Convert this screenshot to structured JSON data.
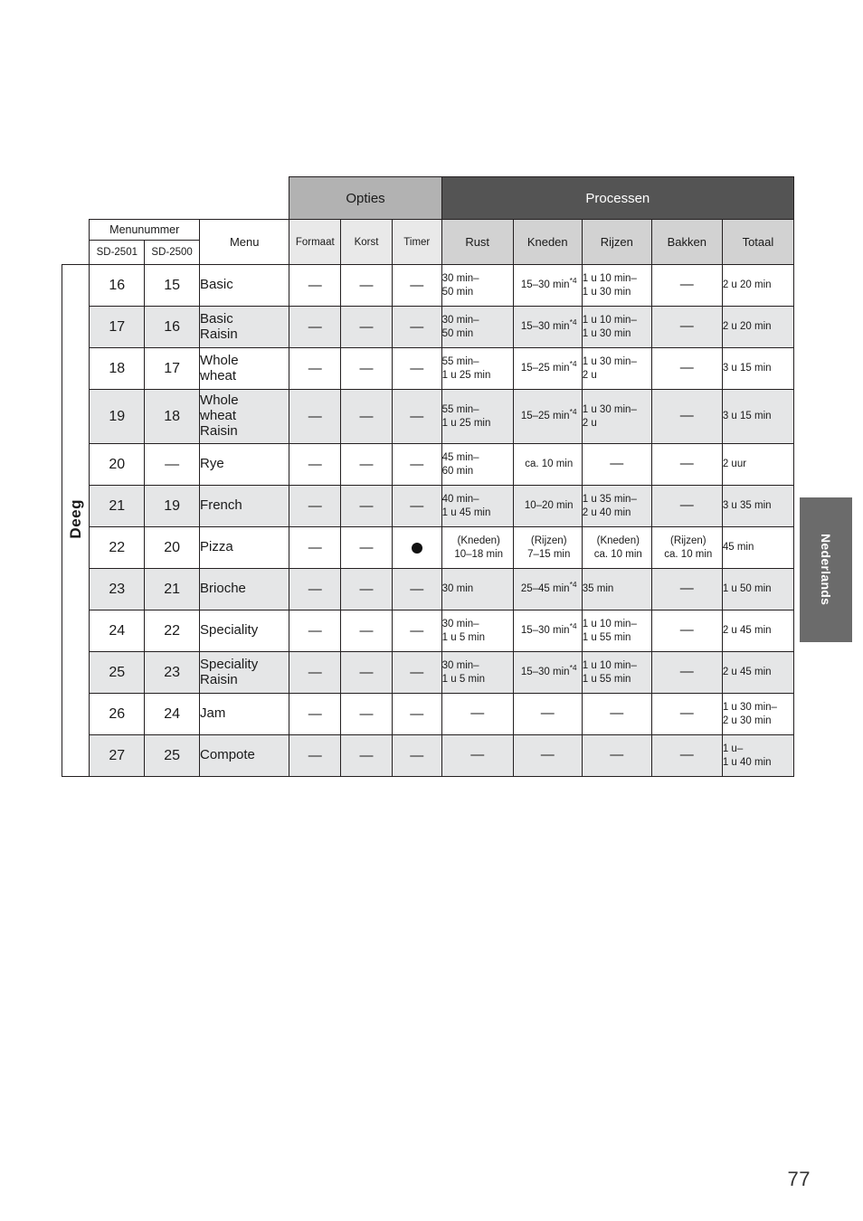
{
  "page": {
    "number": "77",
    "side_tab": "Nederlands"
  },
  "table": {
    "group_headers": {
      "opties": "Opties",
      "processen": "Processen"
    },
    "sub_headers": {
      "menunummer": "Menunummer",
      "model_1": "SD-2501",
      "model_2": "SD-2500",
      "menu": "Menu",
      "formaat": "Formaat",
      "korst": "Korst",
      "timer": "Timer",
      "rust": "Rust",
      "kneden": "Kneden",
      "rijzen": "Rijzen",
      "bakken": "Bakken",
      "totaal": "Totaal"
    },
    "category_label": "Deeg",
    "symbols": {
      "dash": "—",
      "dot": "●"
    },
    "rows": [
      {
        "sd2501": "16",
        "sd2500": "15",
        "menu": "Basic",
        "formaat": "—",
        "korst": "—",
        "timer": "—",
        "rust": "30 min–\n50 min",
        "kneden": "15–30 min",
        "kneden_note": "*4",
        "rijzen": "1 u 10 min–\n1 u 30 min",
        "bakken": "—",
        "totaal": "2 u 20 min"
      },
      {
        "sd2501": "17",
        "sd2500": "16",
        "menu": "Basic\nRaisin",
        "formaat": "—",
        "korst": "—",
        "timer": "—",
        "rust": "30 min–\n50 min",
        "kneden": "15–30 min",
        "kneden_note": "*4",
        "rijzen": "1 u 10 min–\n1 u 30 min",
        "bakken": "—",
        "totaal": "2 u 20 min"
      },
      {
        "sd2501": "18",
        "sd2500": "17",
        "menu": "Whole\nwheat",
        "formaat": "—",
        "korst": "—",
        "timer": "—",
        "rust": "55 min–\n1 u 25 min",
        "kneden": "15–25 min",
        "kneden_note": "*4",
        "rijzen": "1 u 30 min–\n2 u",
        "bakken": "—",
        "totaal": "3 u 15 min"
      },
      {
        "sd2501": "19",
        "sd2500": "18",
        "menu": "Whole\nwheat\nRaisin",
        "formaat": "—",
        "korst": "—",
        "timer": "—",
        "rust": "55 min–\n1 u 25 min",
        "kneden": "15–25 min",
        "kneden_note": "*4",
        "rijzen": "1 u 30 min–\n2 u",
        "bakken": "—",
        "totaal": "3 u 15 min"
      },
      {
        "sd2501": "20",
        "sd2500": "—",
        "menu": "Rye",
        "formaat": "—",
        "korst": "—",
        "timer": "—",
        "rust": "45 min–\n60 min",
        "kneden": "ca. 10 min",
        "kneden_note": "",
        "rijzen": "—",
        "bakken": "—",
        "totaal": "2 uur"
      },
      {
        "sd2501": "21",
        "sd2500": "19",
        "menu": "French",
        "formaat": "—",
        "korst": "—",
        "timer": "—",
        "rust": "40 min–\n1 u 45 min",
        "kneden": "10–20 min",
        "kneden_note": "",
        "rijzen": "1 u 35 min–\n2 u 40 min",
        "bakken": "—",
        "totaal": "3 u 35 min"
      },
      {
        "sd2501": "22",
        "sd2500": "20",
        "menu": "Pizza",
        "formaat": "—",
        "korst": "—",
        "timer": "●",
        "rust": "(Kneden)\n10–18 min",
        "kneden": "(Rijzen)\n7–15 min",
        "kneden_note": "",
        "rijzen": "(Kneden)\nca. 10 min",
        "bakken": "(Rijzen)\nca. 10 min",
        "totaal": "45 min"
      },
      {
        "sd2501": "23",
        "sd2500": "21",
        "menu": "Brioche",
        "formaat": "—",
        "korst": "—",
        "timer": "—",
        "rust": "30 min",
        "kneden": "25–45 min",
        "kneden_note": "*4",
        "rijzen": "35 min",
        "bakken": "—",
        "totaal": "1 u 50 min"
      },
      {
        "sd2501": "24",
        "sd2500": "22",
        "menu": "Speciality",
        "formaat": "—",
        "korst": "—",
        "timer": "—",
        "rust": "30 min–\n1 u 5 min",
        "kneden": "15–30 min",
        "kneden_note": "*4",
        "rijzen": "1 u 10 min–\n1 u 55 min",
        "bakken": "—",
        "totaal": "2 u 45 min"
      },
      {
        "sd2501": "25",
        "sd2500": "23",
        "menu": "Speciality\nRaisin",
        "formaat": "—",
        "korst": "—",
        "timer": "—",
        "rust": "30 min–\n1 u 5 min",
        "kneden": "15–30 min",
        "kneden_note": "*4",
        "rijzen": "1 u 10 min–\n1 u 55 min",
        "bakken": "—",
        "totaal": "2 u 45 min"
      },
      {
        "sd2501": "26",
        "sd2500": "24",
        "menu": "Jam",
        "formaat": "—",
        "korst": "—",
        "timer": "—",
        "rust": "—",
        "kneden": "—",
        "kneden_note": "",
        "rijzen": "—",
        "bakken": "—",
        "totaal": "1 u 30 min–\n2 u 30 min"
      },
      {
        "sd2501": "27",
        "sd2500": "25",
        "menu": "Compote",
        "formaat": "—",
        "korst": "—",
        "timer": "—",
        "rust": "—",
        "kneden": "—",
        "kneden_note": "",
        "rijzen": "—",
        "bakken": "—",
        "totaal": "1 u–\n1 u 40 min"
      }
    ]
  }
}
